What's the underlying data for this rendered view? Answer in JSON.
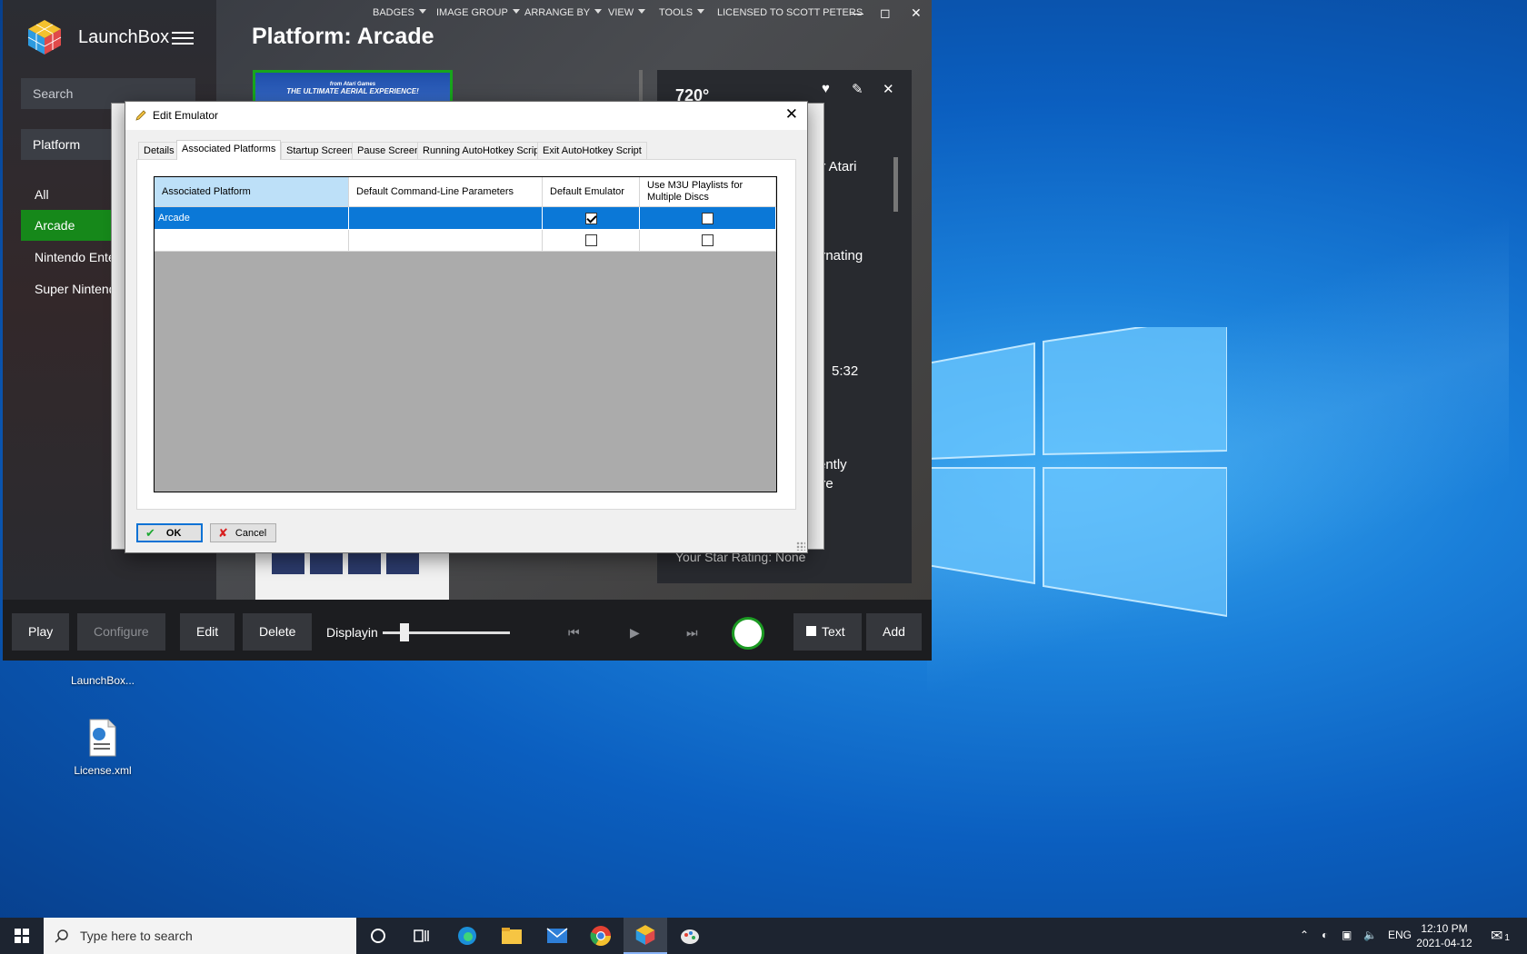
{
  "launchbox": {
    "app_name": "LaunchBox",
    "search_placeholder": "Search",
    "filter_label": "Platform",
    "list": [
      "All",
      "Arcade",
      "Nintendo Ente",
      "Super Nintend"
    ],
    "menu": {
      "badges": "BADGES",
      "image_group": "IMAGE GROUP",
      "arrange_by": "ARRANGE BY",
      "view": "VIEW",
      "tools": "TOOLS",
      "license": "LICENSED TO SCOTT PETERS"
    },
    "heading": "Platform: Arcade",
    "cover_text": "THE ULTIMATE AERIAL EXPERIENCE!",
    "cover_small": "from Atari Games",
    "detail": {
      "title": "720°",
      "line1": "er Atari",
      "line2": "ernating",
      "line3": "5:32",
      "line4": "rently",
      "line5": "ore",
      "rating": "Your Star Rating: None"
    },
    "bottom": {
      "play": "Play",
      "configure": "Configure",
      "edit": "Edit",
      "delete": "Delete",
      "display": "Displayin",
      "text": "Text",
      "add": "Add"
    }
  },
  "dialog": {
    "title": "Edit Emulator",
    "tabs": [
      "Details",
      "Associated Platforms",
      "Startup Screen",
      "Pause Screen",
      "Running AutoHotkey Script",
      "Exit AutoHotkey Script"
    ],
    "columns": [
      "Associated Platform",
      "Default Command-Line Parameters",
      "Default Emulator",
      "Use M3U Playlists for Multiple Discs"
    ],
    "rows": [
      {
        "platform": "Arcade",
        "params": "",
        "default": true,
        "m3u": false
      },
      {
        "platform": "",
        "params": "",
        "default": false,
        "m3u": false
      }
    ],
    "ok": "OK",
    "cancel": "Cancel"
  },
  "desktop": {
    "icons": [
      "LaunchBox...",
      "License.xml"
    ]
  },
  "taskbar": {
    "search_placeholder": "Type here to search",
    "lang": "ENG",
    "time": "12:10 PM",
    "date": "2021-04-12",
    "notif_count": "1"
  }
}
